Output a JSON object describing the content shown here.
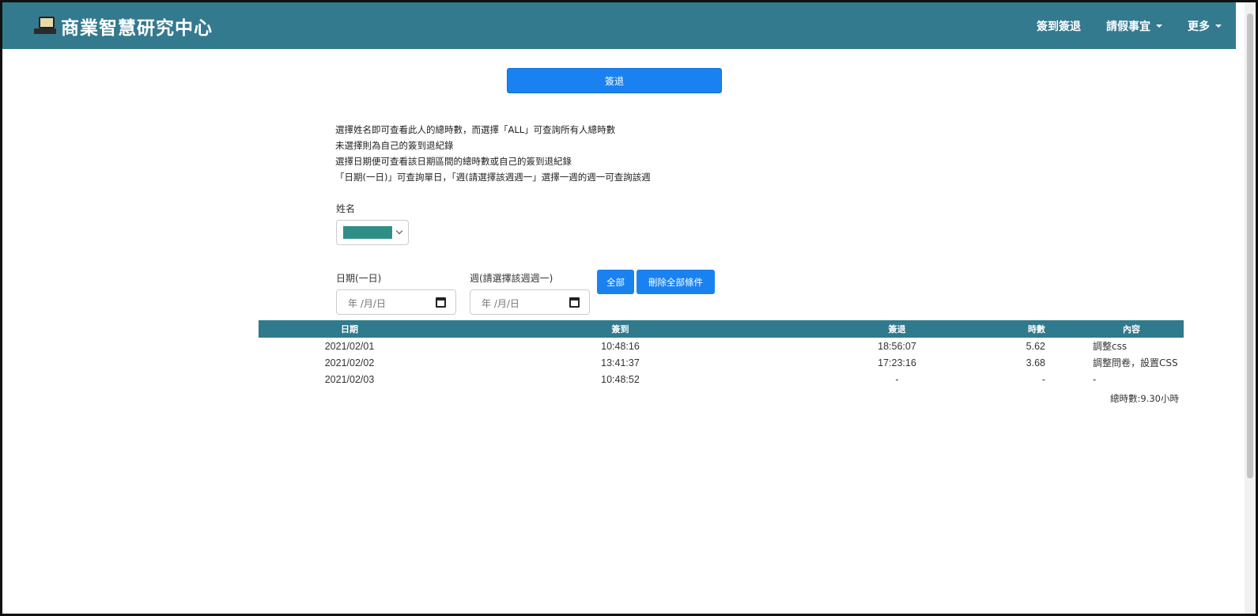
{
  "navbar": {
    "brand": "商業智慧研究中心",
    "items": [
      {
        "label": "簽到簽退"
      },
      {
        "label": "請假事宜"
      },
      {
        "label": "更多"
      }
    ]
  },
  "main": {
    "checkout_button": "簽退",
    "instructions": [
      "選擇姓名即可查看此人的總時數，而選擇「ALL」可查詢所有人總時數",
      "未選擇則為自己的簽到退紀錄",
      "選擇日期便可查看該日期區間的總時數或自己的簽到退紀錄",
      "「日期(一日)」可查詢單日，「週(請選擇該週週一」選擇一週的週一可查詢該週"
    ],
    "name_label": "姓名",
    "date_label": "日期(一日)",
    "week_label": "週(請選擇該週週一)",
    "date_placeholder": "年 /月/日",
    "week_placeholder": "年 /月/日",
    "all_button": "全部",
    "clear_button": "刪除全部條件"
  },
  "table": {
    "headers": [
      "日期",
      "簽到",
      "簽退",
      "時數",
      "內容"
    ],
    "rows": [
      {
        "date": "2021/02/01",
        "in": "10:48:16",
        "out": "18:56:07",
        "hours": "5.62",
        "content": "調整css"
      },
      {
        "date": "2021/02/02",
        "in": "13:41:37",
        "out": "17:23:16",
        "hours": "3.68",
        "content": "調整問卷，設置CSS"
      },
      {
        "date": "2021/02/03",
        "in": "10:48:52",
        "out": "-",
        "hours": "-",
        "content": "-"
      }
    ],
    "total": "總時數:9.30小時"
  },
  "colors": {
    "navbar": "#337a8f",
    "primary_button": "#1a82f0",
    "table_header": "#2f7a8c"
  },
  "icons": {
    "brand": "computer-icon",
    "dropdown": "caret-down-icon",
    "calendar": "calendar-icon"
  }
}
